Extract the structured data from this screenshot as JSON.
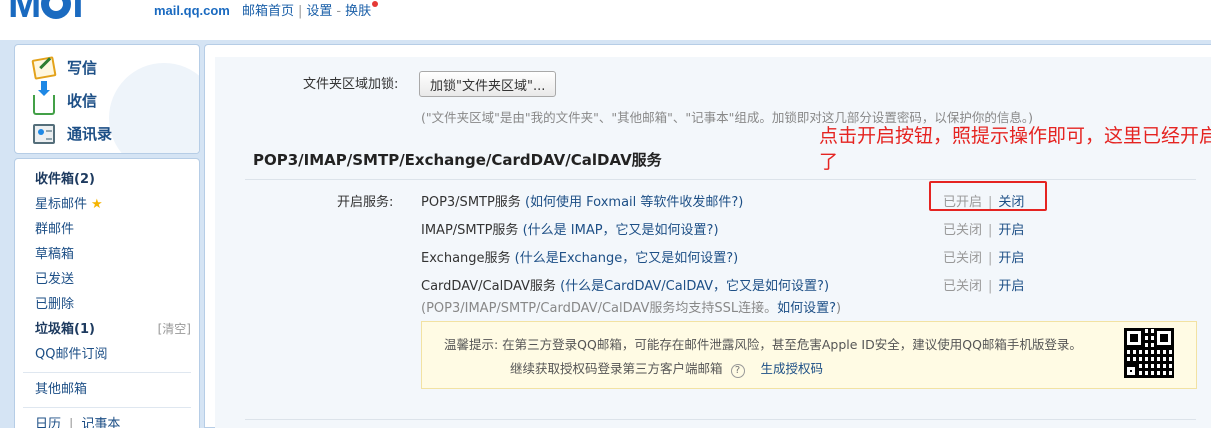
{
  "header": {
    "logo_text": "MOI",
    "logo_domain": "mail.qq.com",
    "links": [
      {
        "label": "邮箱首页"
      },
      {
        "label": "设置"
      },
      {
        "label": "换肤"
      }
    ]
  },
  "sidebar": {
    "actions": [
      {
        "label": "写信",
        "icon": "compose-icon"
      },
      {
        "label": "收信",
        "icon": "inbox-icon"
      },
      {
        "label": "通讯录",
        "icon": "contacts-icon"
      }
    ],
    "folders": {
      "inbox": "收件箱(2)",
      "starred": "星标邮件",
      "group": "群邮件",
      "drafts": "草稿箱",
      "sent": "已发送",
      "deleted": "已删除",
      "spam": "垃圾箱(1)",
      "spam_clear": "[清空]",
      "subscriptions": "QQ邮件订阅",
      "other": "其他邮箱",
      "calendar": "日历",
      "notes": "记事本"
    }
  },
  "main": {
    "lock": {
      "label": "文件夹区域加锁:",
      "button": "加锁\"文件夹区域\"...",
      "hint": "(\"文件夹区域\"是由\"我的文件夹\"、\"其他邮箱\"、\"记事本\"组成。加锁即对这几部分设置密码，以保护你的信息。)"
    },
    "section_title": "POP3/IMAP/SMTP/Exchange/CardDAV/CalDAV服务",
    "annotation": "点击开启按钮，照提示操作即可，这里已经开启了",
    "services_label": "开启服务:",
    "services": [
      {
        "name": "POP3/SMTP服务",
        "help": "(如何使用 Foxmail 等软件收发邮件?)",
        "status": "已开启",
        "action": "关闭"
      },
      {
        "name": "IMAP/SMTP服务",
        "help": "(什么是 IMAP，它又是如何设置?)",
        "status": "已关闭",
        "action": "开启"
      },
      {
        "name": "Exchange服务",
        "help": "(什么是Exchange，它又是如何设置?)",
        "status": "已关闭",
        "action": "开启"
      },
      {
        "name": "CardDAV/CalDAV服务",
        "help": "(什么是CardDAV/CalDAV，它又是如何设置?)",
        "status": "已关闭",
        "action": "开启"
      }
    ],
    "ssl_note": "(POP3/IMAP/SMTP/CardDAV/CalDAV服务均支持SSL连接。",
    "ssl_link": "如何设置?",
    "ssl_note_end": ")",
    "tip": {
      "line1": "温馨提示: 在第三方登录QQ邮箱，可能存在邮件泄露风险，甚至危害Apple ID安全，建议使用QQ邮箱手机版登录。",
      "line2": "继续获取授权码登录第三方客户端邮箱",
      "help_glyph": "?",
      "generate": "生成授权码"
    }
  },
  "colors": {
    "accent": "#1d4f86",
    "annotation_red": "#e52421",
    "background": "#d5e4f4"
  }
}
